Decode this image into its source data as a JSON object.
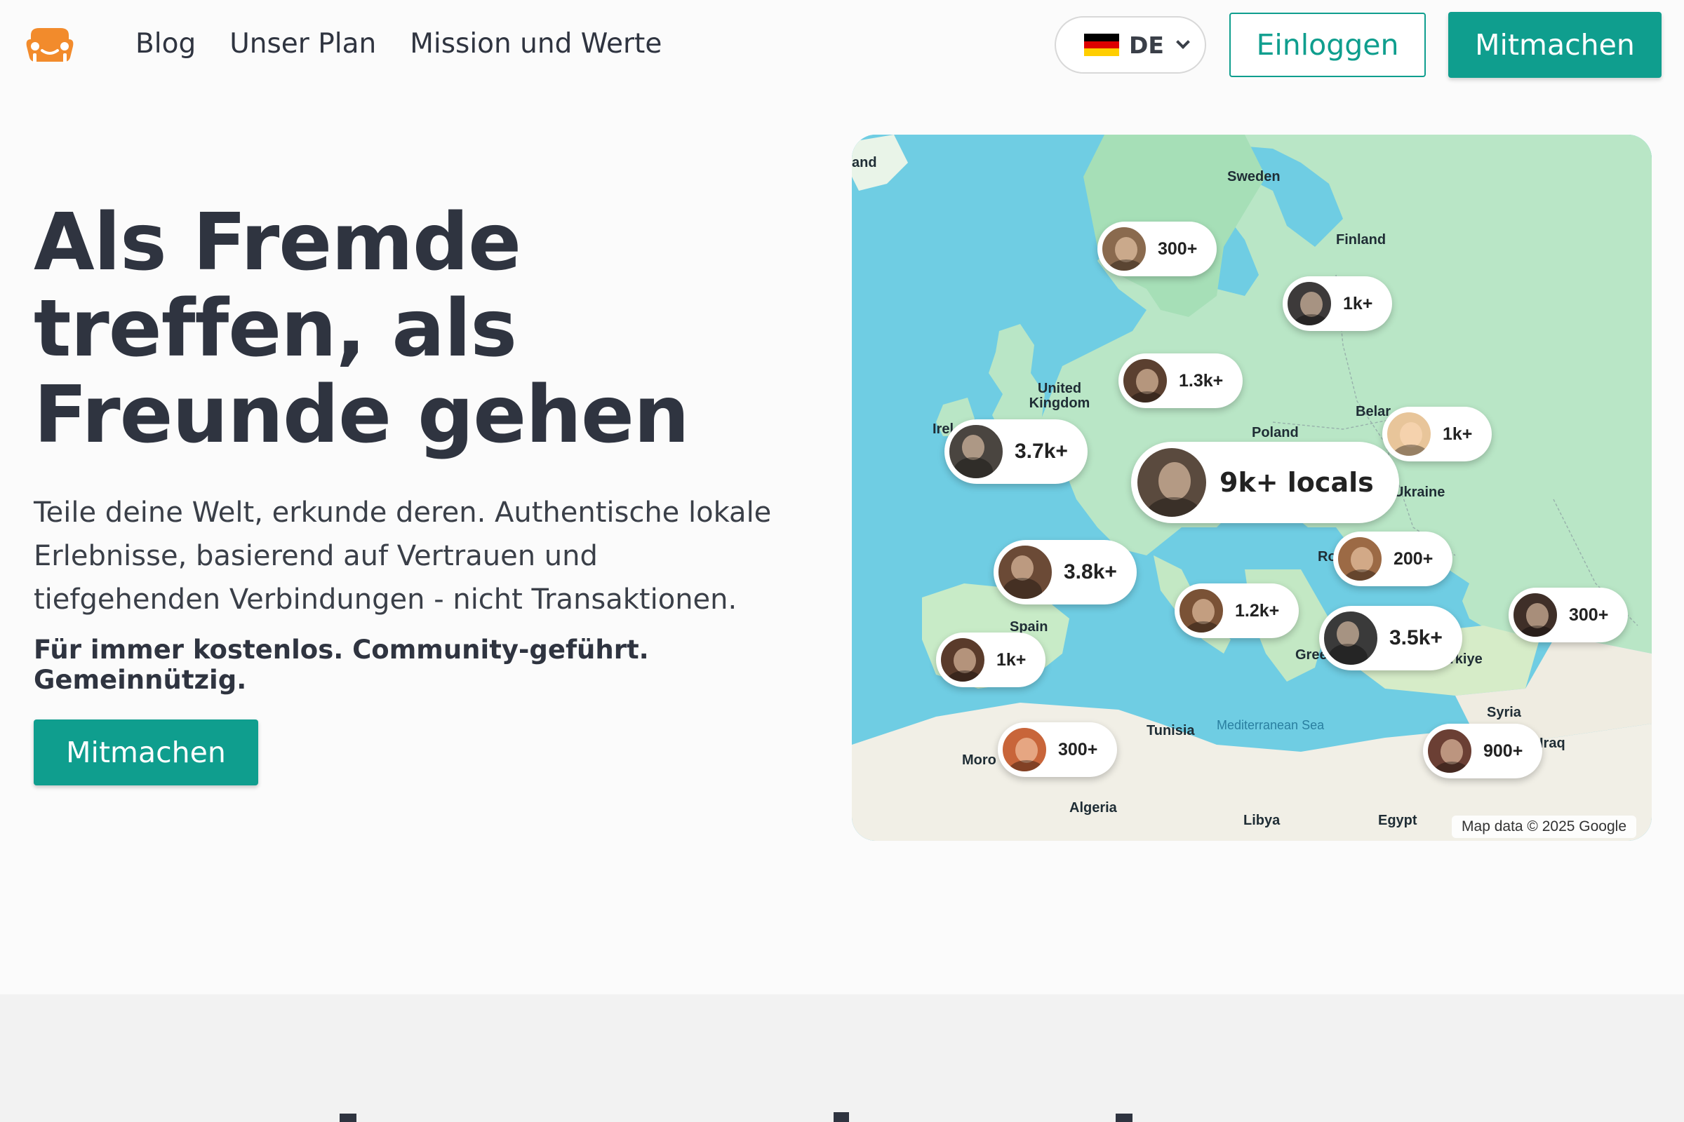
{
  "nav": {
    "logo_icon": "sofa-logo-icon",
    "links": [
      "Blog",
      "Unser Plan",
      "Mission und Werte"
    ],
    "language": {
      "code": "DE",
      "flag": "german-flag-icon"
    },
    "login_label": "Einloggen",
    "join_label": "Mitmachen"
  },
  "hero": {
    "headline": "Als Fremde treffen, als Freunde gehen",
    "subtitle": "Teile deine Welt, erkunde deren. Authentische lokale Erlebnisse, basierend auf Vertrauen und tiefgehenden Verbindungen - nicht Transaktionen.",
    "tagline": "Für immer kostenlos. Community-geführt. Gemeinnützig.",
    "cta_label": "Mitmachen"
  },
  "map": {
    "places": [
      "and",
      "Sweden",
      "Finland",
      "United Kingdom",
      "Irel",
      "Poland",
      "Belar",
      "Ukraine",
      "Ro",
      "Spain",
      "Gree",
      "rkiye",
      "Syria",
      "Iraq",
      "Moro",
      "Tunisia",
      "Algeria",
      "Libya",
      "Egypt"
    ],
    "sea_label": "Mediterranean Sea",
    "credit": "Map data © 2025 Google",
    "pins": [
      {
        "count": "300+",
        "avatar": "#8a6a4e"
      },
      {
        "count": "1k+",
        "avatar": "#3d3a3a"
      },
      {
        "count": "1.3k+",
        "avatar": "#5b4030"
      },
      {
        "count": "3.7k+",
        "avatar": "#4a4540"
      },
      {
        "count": "1k+",
        "avatar": "#e8c59a"
      },
      {
        "count": "9k+ locals",
        "avatar": "#5a4a3e"
      },
      {
        "count": "200+",
        "avatar": "#9c6a45"
      },
      {
        "count": "3.8k+",
        "avatar": "#6b4a36"
      },
      {
        "count": "1.2k+",
        "avatar": "#7a5236"
      },
      {
        "count": "3.5k+",
        "avatar": "#3a3a3a"
      },
      {
        "count": "300+",
        "avatar": "#3f2f28"
      },
      {
        "count": "1k+",
        "avatar": "#5a3b2b"
      },
      {
        "count": "300+",
        "avatar": "#c8653a"
      },
      {
        "count": "900+",
        "avatar": "#6b3f34"
      }
    ]
  }
}
